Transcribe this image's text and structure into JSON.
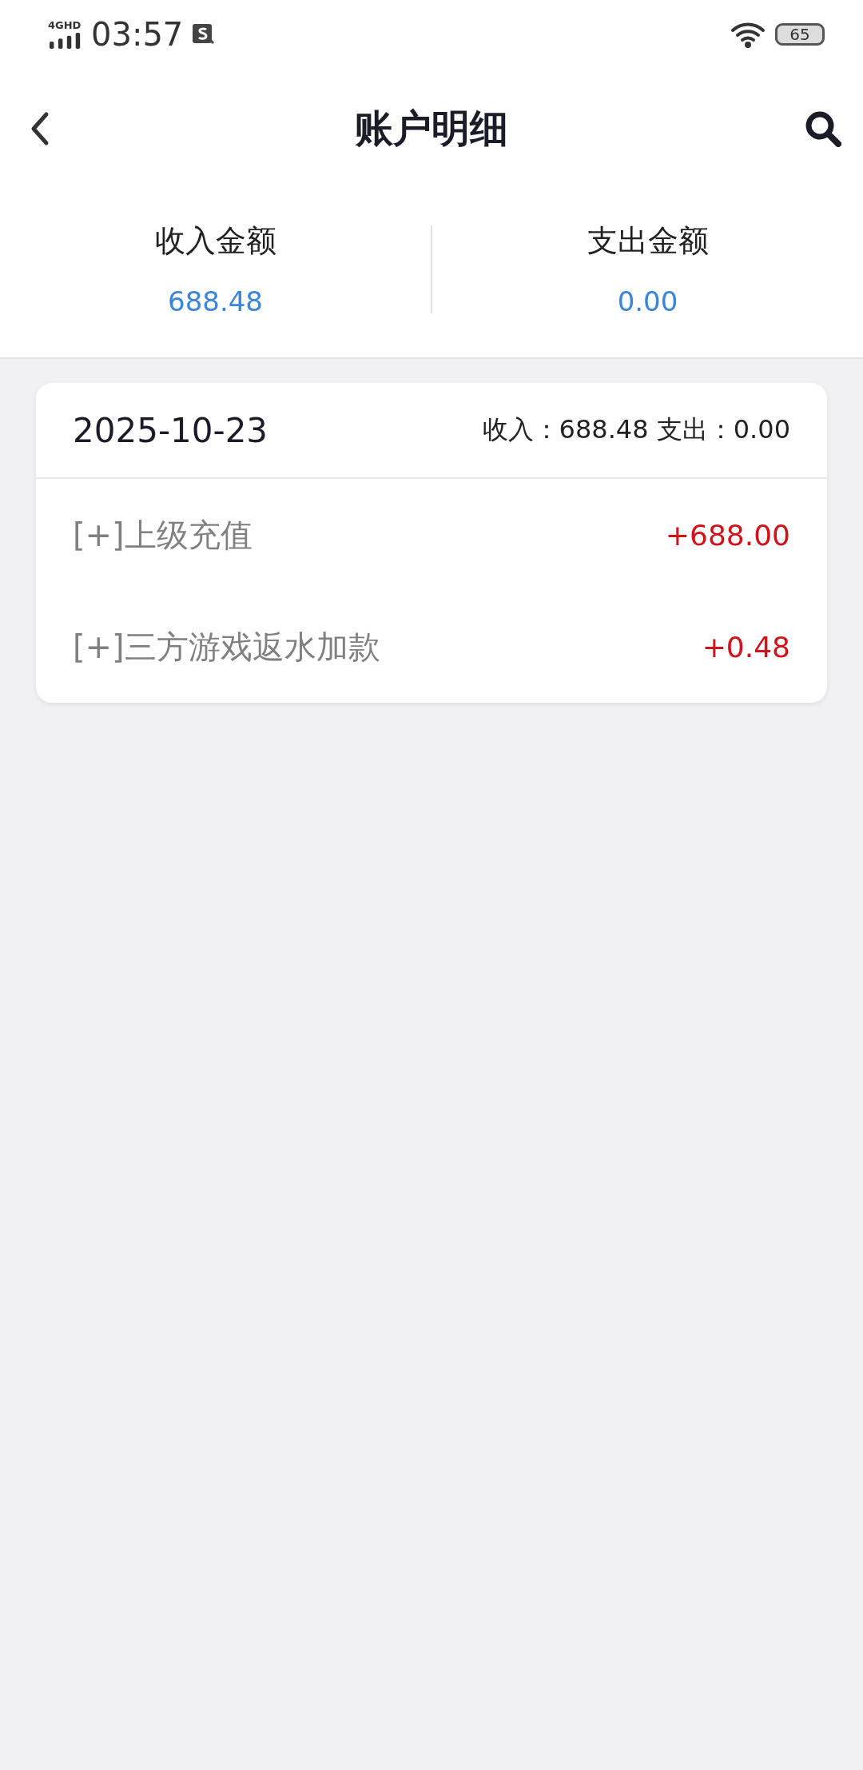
{
  "status_bar": {
    "network": "4GHD",
    "time": "03:57",
    "battery": "65"
  },
  "header": {
    "title": "账户明细"
  },
  "summary": [
    {
      "label": "收入金额",
      "value": "688.48"
    },
    {
      "label": "支出金额",
      "value": "0.00"
    }
  ],
  "days": [
    {
      "date": "2025-10-23",
      "totals": "收入：688.48 支出：0.00",
      "entries": [
        {
          "name": "[+]上级充值",
          "amount": "+688.00"
        },
        {
          "name": "[+]三方游戏返水加款",
          "amount": "+0.48"
        }
      ]
    }
  ]
}
